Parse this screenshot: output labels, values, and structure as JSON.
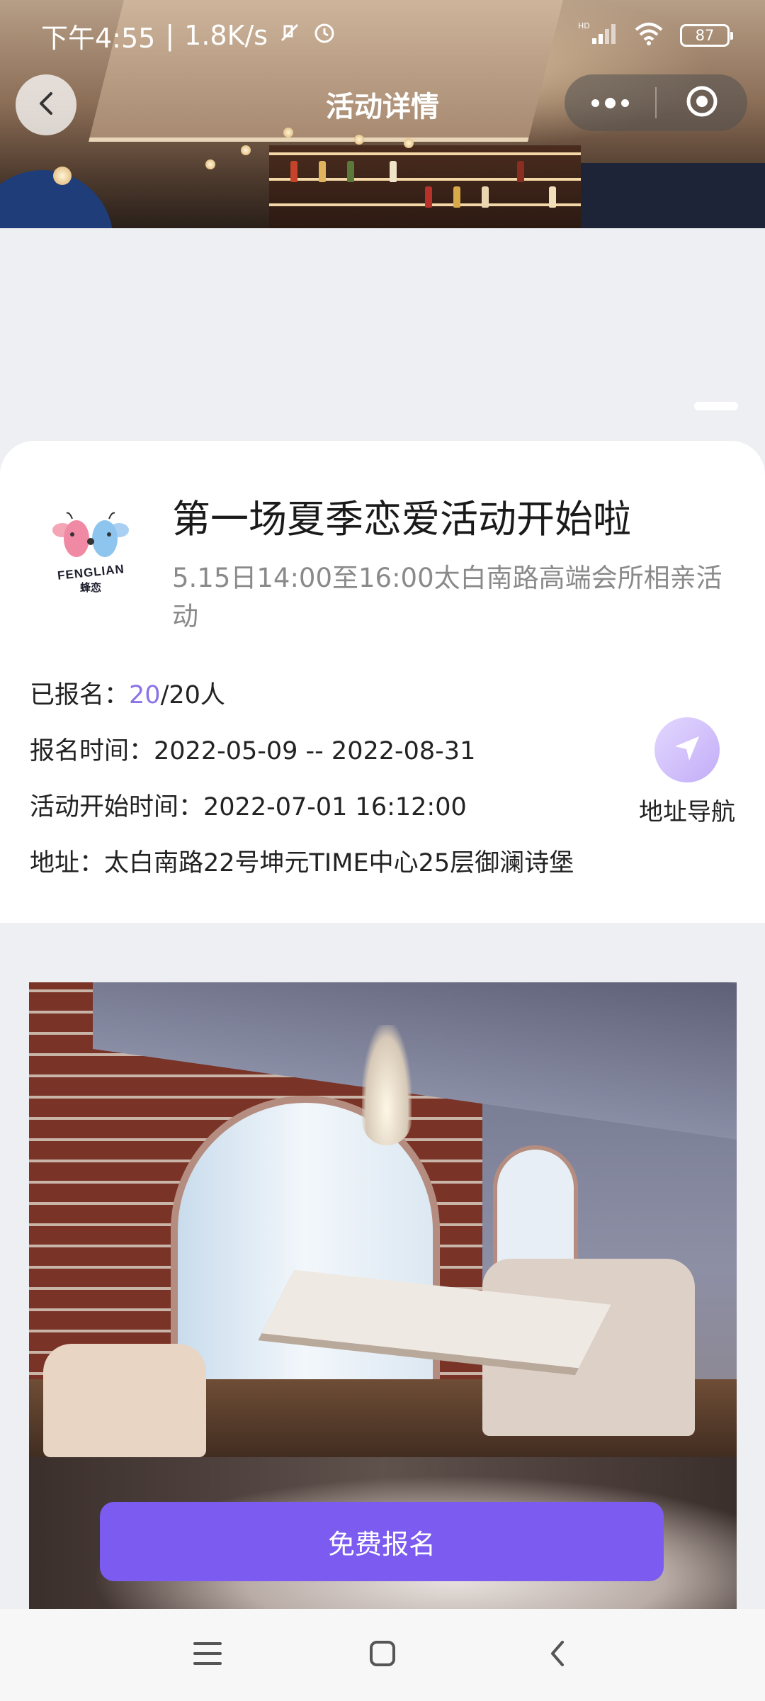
{
  "status_bar": {
    "time": "下午4:55",
    "separator": "|",
    "net_speed": "1.8K/s",
    "signal_label": "HD",
    "battery": "87"
  },
  "nav": {
    "title": "活动详情"
  },
  "event": {
    "logo_text": "FENGLIAN",
    "logo_sub": "蜂恋",
    "title": "第一场夏季恋爱活动开始啦",
    "subtitle": "5.15日14:00至16:00太白南路高端会所相亲活动",
    "signup_label": "已报名：",
    "signup_count": "20",
    "signup_total": "/20人",
    "signup_time_label": "报名时间：",
    "signup_time": "2022-05-09 -- 2022-08-31",
    "start_time_label": "活动开始时间：",
    "start_time": "2022-07-01 16:12:00",
    "address_label": "地址：",
    "address": "太白南路22号坤元TIME中心25层御澜诗堡",
    "nav_action_label": "地址导航"
  },
  "cta": {
    "label": "免费报名"
  },
  "colors": {
    "accent": "#7b5bf0",
    "highlight": "#8b73e6",
    "nav_circle": "#c2acf7"
  },
  "icons": [
    "back-arrow-icon",
    "more-dots-icon",
    "close-circle-icon",
    "navigate-arrow-icon",
    "menu-icon",
    "home-icon",
    "back-icon",
    "wifi-icon",
    "signal-icon",
    "alarm-icon",
    "mute-icon"
  ]
}
